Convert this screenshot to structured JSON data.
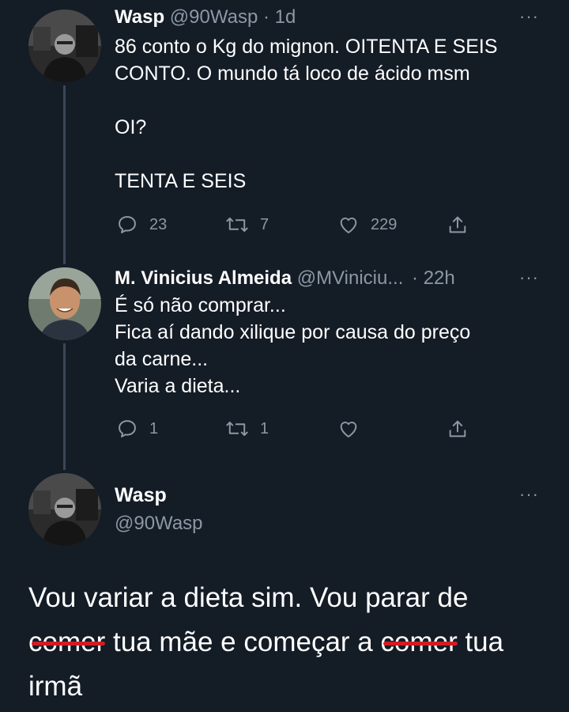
{
  "tweet1": {
    "name": "Wasp",
    "handle_time": "@90Wasp · 1d",
    "text": "86 conto o Kg do mignon. OITENTA E SEIS\nCONTO. O mundo tá loco de ácido msm\n\nOI?\n\nTENTA E SEIS",
    "replies": "23",
    "retweets": "7",
    "likes": "229",
    "more": "···"
  },
  "tweet2": {
    "name": "M. Vinicius Almeida",
    "handle": "@MViniciu...",
    "time": "· 22h",
    "text": "É só não comprar...\nFica aí dando xilique por causa do preço\nda carne...\nVaria a dieta...",
    "replies": "1",
    "retweets": "1",
    "more": "···"
  },
  "main": {
    "name": "Wasp",
    "handle": "@90Wasp",
    "more": "···",
    "text_part1": "Vou variar a dieta sim. Vou parar de",
    "struck1": "comer",
    "text_part2": " tua mãe e começar a ",
    "struck2": "comer",
    "text_part3": " tua",
    "text_part4": "irmã"
  },
  "colors": {
    "background": "#141c26",
    "secondary_text": "#8b98a5",
    "strike": "#d51a22"
  },
  "icons": [
    "reply-icon",
    "retweet-icon",
    "like-icon",
    "share-icon",
    "more-icon"
  ]
}
